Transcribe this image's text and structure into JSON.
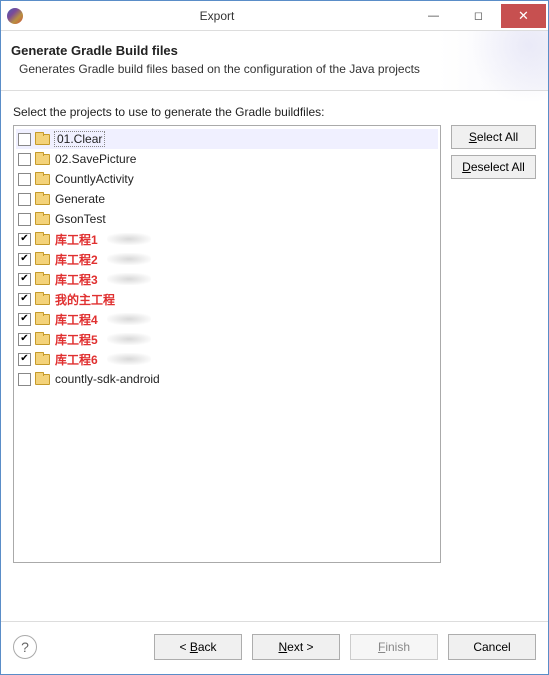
{
  "window": {
    "title": "Export"
  },
  "header": {
    "title": "Generate Gradle Build files",
    "subtitle": "Generates Gradle build files based on the configuration of the Java projects"
  },
  "instruction": "Select the projects to use to generate the Gradle buildfiles:",
  "side": {
    "select_all": "Select All",
    "select_all_mnemonic": "S",
    "deselect_all": "Deselect All",
    "deselect_all_mnemonic": "D"
  },
  "projects": [
    {
      "name": "01.Clear",
      "checked": false,
      "red": false,
      "smudge": false,
      "selected": true
    },
    {
      "name": "02.SavePicture",
      "checked": false,
      "red": false,
      "smudge": false,
      "selected": false
    },
    {
      "name": "CountlyActivity",
      "checked": false,
      "red": false,
      "smudge": false,
      "selected": false
    },
    {
      "name": "Generate",
      "checked": false,
      "red": false,
      "smudge": false,
      "selected": false
    },
    {
      "name": "GsonTest",
      "checked": false,
      "red": false,
      "smudge": false,
      "selected": false
    },
    {
      "name": "库工程1",
      "checked": true,
      "red": true,
      "smudge": true,
      "selected": false
    },
    {
      "name": "库工程2",
      "checked": true,
      "red": true,
      "smudge": true,
      "selected": false
    },
    {
      "name": "库工程3",
      "checked": true,
      "red": true,
      "smudge": true,
      "selected": false
    },
    {
      "name": "我的主工程",
      "checked": true,
      "red": true,
      "smudge": false,
      "selected": false
    },
    {
      "name": "库工程4",
      "checked": true,
      "red": true,
      "smudge": true,
      "selected": false
    },
    {
      "name": "库工程5",
      "checked": true,
      "red": true,
      "smudge": true,
      "selected": false
    },
    {
      "name": "库工程6",
      "checked": true,
      "red": true,
      "smudge": true,
      "selected": false
    },
    {
      "name": "countly-sdk-android",
      "checked": false,
      "red": false,
      "smudge": false,
      "selected": false
    }
  ],
  "buttons": {
    "back": "< Back",
    "back_mnemonic": "B",
    "next": "Next >",
    "next_mnemonic": "N",
    "finish": "Finish",
    "finish_mnemonic": "F",
    "cancel": "Cancel"
  }
}
